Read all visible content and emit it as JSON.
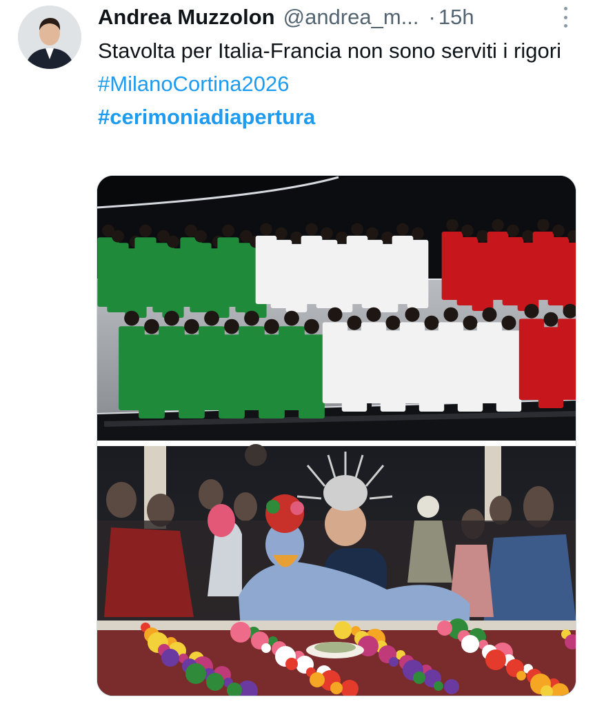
{
  "author": {
    "display_name": "Andrea Muzzolon",
    "handle": "@andrea_m...",
    "separator": "·",
    "time": "15h"
  },
  "tweet": {
    "text": "Stavolta per Italia-Francia non sono serviti i rigori",
    "hashtags": [
      "#MilanoCortina2026",
      "#cerimoniadiapertura"
    ]
  },
  "icons": {
    "avatar": "user-avatar",
    "more": "more-vertical-icon"
  },
  "media": {
    "images": [
      "opening-ceremony-tricolor-performers",
      "seine-banquet-performers"
    ]
  },
  "colors": {
    "hashtag": "#1d9bf0",
    "secondary_text": "#536471",
    "italy_green": "#1f8a3a",
    "italy_white": "#f2f2f2",
    "italy_red": "#c8161d"
  }
}
